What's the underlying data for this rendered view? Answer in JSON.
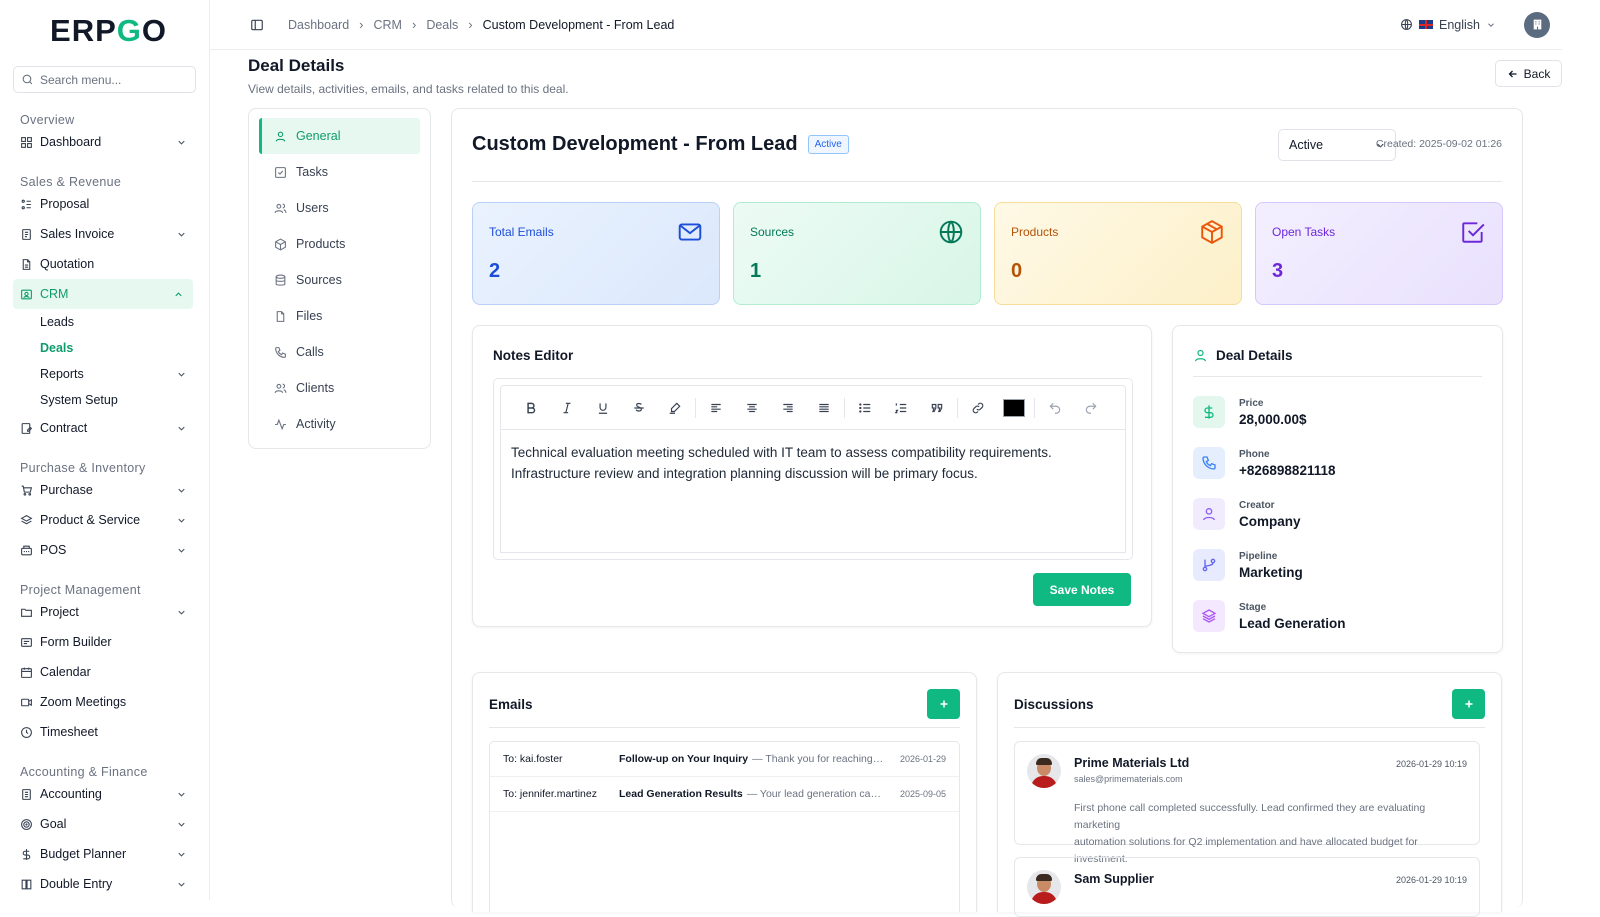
{
  "brand": {
    "logo_pre": "E",
    "logo_mid": "RP",
    "logo_g": "G",
    "logo_post": "O"
  },
  "sidebar": {
    "search_placeholder": "Search menu...",
    "sections": {
      "overview": "Overview",
      "sales": "Sales & Revenue",
      "purchase": "Purchase & Inventory",
      "project": "Project Management",
      "accounting": "Accounting & Finance"
    },
    "items": {
      "dashboard": "Dashboard",
      "proposal": "Proposal",
      "sales_invoice": "Sales Invoice",
      "quotation": "Quotation",
      "crm": "CRM",
      "leads": "Leads",
      "deals": "Deals",
      "reports": "Reports",
      "system_setup": "System Setup",
      "contract": "Contract",
      "purchase": "Purchase",
      "product_service": "Product & Service",
      "pos": "POS",
      "project": "Project",
      "form_builder": "Form Builder",
      "calendar": "Calendar",
      "zoom": "Zoom Meetings",
      "timesheet": "Timesheet",
      "accounting": "Accounting",
      "goal": "Goal",
      "budget": "Budget Planner",
      "double_entry": "Double Entry"
    }
  },
  "topbar": {
    "breadcrumbs": [
      "Dashboard",
      "CRM",
      "Deals",
      "Custom Development - From Lead"
    ],
    "language": "English"
  },
  "page": {
    "title": "Deal Details",
    "subtitle": "View details, activities, emails, and tasks related to this deal.",
    "back_label": "Back"
  },
  "tabs": [
    "General",
    "Tasks",
    "Users",
    "Products",
    "Sources",
    "Files",
    "Calls",
    "Clients",
    "Activity"
  ],
  "deal": {
    "name": "Custom Development - From Lead",
    "badge": "Active",
    "status_value": "Active",
    "created": "Created: 2025-09-02 01:26"
  },
  "stats": [
    {
      "label": "Total Emails",
      "value": "2",
      "icon": "mail-icon"
    },
    {
      "label": "Sources",
      "value": "1",
      "icon": "globe-icon"
    },
    {
      "label": "Products",
      "value": "0",
      "icon": "box-icon"
    },
    {
      "label": "Open Tasks",
      "value": "3",
      "icon": "checkbox-icon"
    }
  ],
  "notes": {
    "title": "Notes Editor",
    "line1": "Technical evaluation meeting scheduled with IT team to assess compatibility requirements.",
    "line2": "Infrastructure review and integration planning discussion will be primary focus.",
    "save_label": "Save Notes",
    "text_color": "#000000"
  },
  "details": {
    "title": "Deal Details",
    "rows": [
      {
        "label": "Price",
        "value": "28,000.00$"
      },
      {
        "label": "Phone",
        "value": "+826898821118"
      },
      {
        "label": "Creator",
        "value": "Company"
      },
      {
        "label": "Pipeline",
        "value": "Marketing"
      },
      {
        "label": "Stage",
        "value": "Lead Generation"
      }
    ]
  },
  "emails": {
    "title": "Emails",
    "rows": [
      {
        "to": "To: kai.foster",
        "subject": "Follow-up on Your Inquiry",
        "preview": "— Thank you for reaching out to us regarding",
        "date": "2026-01-29"
      },
      {
        "to": "To: jennifer.martinez",
        "subject": "Lead Generation Results",
        "preview": "— Your lead generation campaign has",
        "date": "2025-09-05"
      }
    ]
  },
  "discussions": {
    "title": "Discussions",
    "items": [
      {
        "name": "Prime Materials Ltd",
        "email": "sales@primematerials.com",
        "date": "2026-01-29 10:19",
        "msg1": "First phone call completed successfully. Lead confirmed they are evaluating marketing",
        "msg2": "automation solutions for Q2 implementation and have allocated budget for investment."
      },
      {
        "name": "Sam Supplier",
        "date": "2026-01-29 10:19"
      }
    ]
  },
  "colors": {
    "accent": "#10b981",
    "accent_dark": "#0f9d6e"
  }
}
